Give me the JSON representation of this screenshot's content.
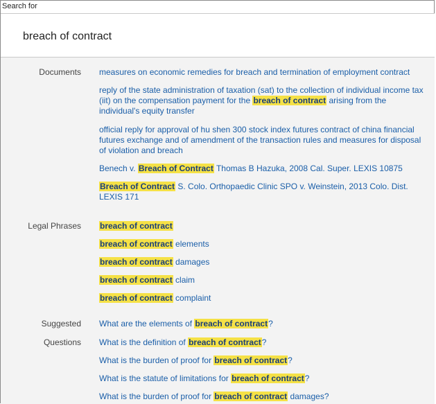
{
  "search": {
    "label": "Search for",
    "value": "breach of contract"
  },
  "sections": {
    "documents": "Documents",
    "legal_phrases": "Legal Phrases",
    "suggested_line1": "Suggested",
    "suggested_line2": "Questions"
  },
  "documents": [
    {
      "pre": "measures on economic remedies for breach and termination of employment contract",
      "hl": "",
      "post": ""
    },
    {
      "pre": "reply of the state administration of taxation (sat) to the collection of individual income tax (iit) on the compensation payment for the ",
      "hl": "breach of contract",
      "post": " arising from the individual's equity transfer"
    },
    {
      "pre": "official reply for approval of hu shen 300 stock index futures contract of china financial futures exchange and of amendment of the transaction rules and measures for disposal of violation and breach",
      "hl": "",
      "post": ""
    },
    {
      "pre": "Benech v. ",
      "hl": "Breach of Contract",
      "post": " Thomas B Hazuka, 2008 Cal. Super. LEXIS 10875"
    },
    {
      "pre": "",
      "hl": "Breach of Contract",
      "post": " S. Colo. Orthopaedic Clinic SPO v. Weinstein, 2013 Colo. Dist. LEXIS 171"
    }
  ],
  "phrases": [
    {
      "pre": "",
      "hl": "breach of contract",
      "post": ""
    },
    {
      "pre": "",
      "hl": "breach of contract",
      "post": " elements"
    },
    {
      "pre": "",
      "hl": "breach of contract",
      "post": " damages"
    },
    {
      "pre": "",
      "hl": "breach of contract",
      "post": " claim"
    },
    {
      "pre": "",
      "hl": "breach of contract",
      "post": " complaint"
    }
  ],
  "questions": [
    {
      "pre": "What are the elements of ",
      "hl": "breach of contract",
      "post": "?"
    },
    {
      "pre": "What is the definition of ",
      "hl": "breach of contract",
      "post": "?"
    },
    {
      "pre": "What is the burden of proof for ",
      "hl": "breach of contract",
      "post": "?"
    },
    {
      "pre": "What is the statute of limitations for ",
      "hl": "breach of contract",
      "post": "?"
    },
    {
      "pre": "What is the burden of proof for ",
      "hl": "breach of contract",
      "post": " damages?"
    }
  ]
}
